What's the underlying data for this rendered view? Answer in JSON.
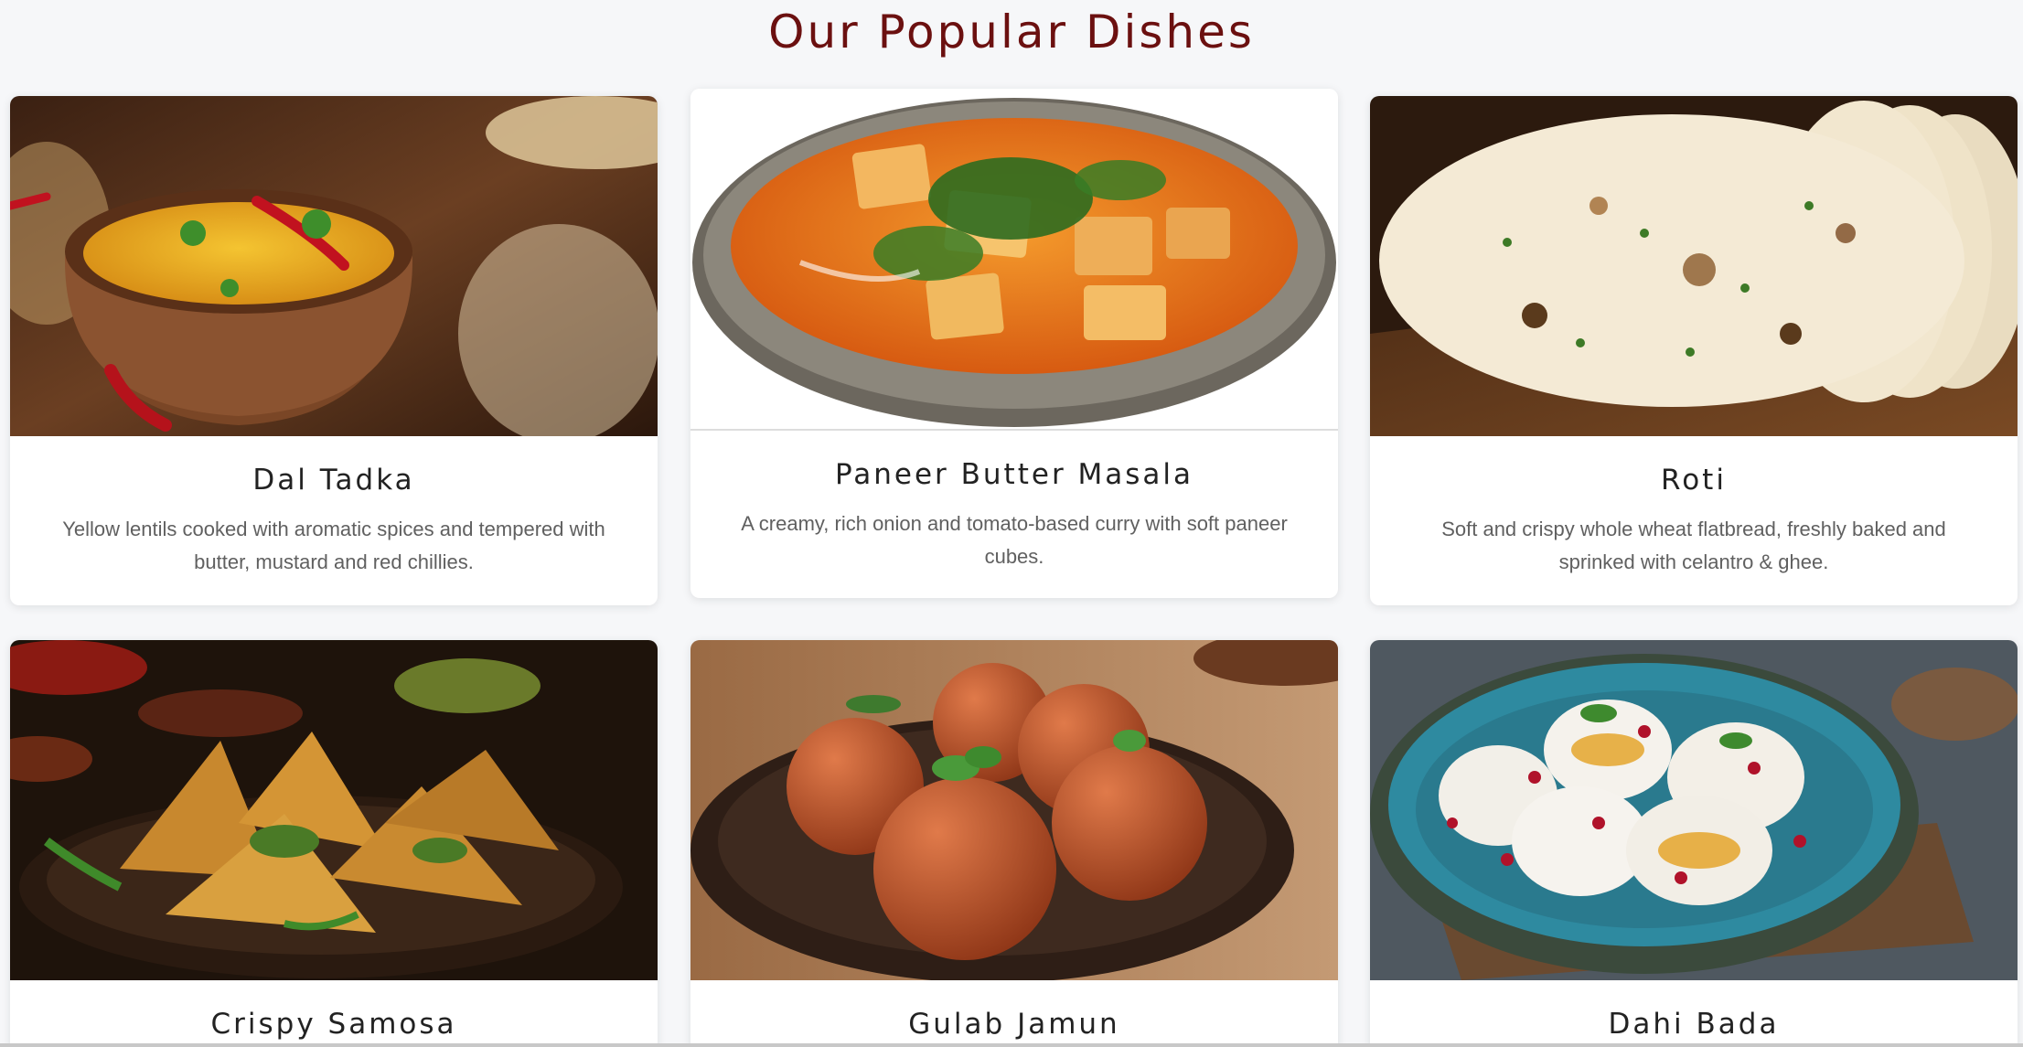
{
  "section": {
    "title": "Our Popular Dishes"
  },
  "dishes": [
    {
      "name": "Dal Tadka",
      "description": "Yellow lentils cooked with aromatic spices and tempered with butter, mustard and red chillies.",
      "image_icon": "dal-tadka-photo"
    },
    {
      "name": "Paneer Butter Masala",
      "description": "A creamy, rich onion and tomato-based curry with soft paneer cubes.",
      "image_icon": "paneer-butter-masala-photo"
    },
    {
      "name": "Roti",
      "description": "Soft and crispy whole wheat flatbread, freshly baked and sprinked with celantro & ghee.",
      "image_icon": "roti-photo"
    },
    {
      "name": "Crispy Samosa",
      "description": "",
      "image_icon": "samosa-photo"
    },
    {
      "name": "Gulab Jamun",
      "description": "",
      "image_icon": "gulab-jamun-photo"
    },
    {
      "name": "Dahi Bada",
      "description": "",
      "image_icon": "dahi-bada-photo"
    }
  ],
  "colors": {
    "title": "#6b1010",
    "background": "#f6f7f9",
    "card": "#ffffff"
  }
}
